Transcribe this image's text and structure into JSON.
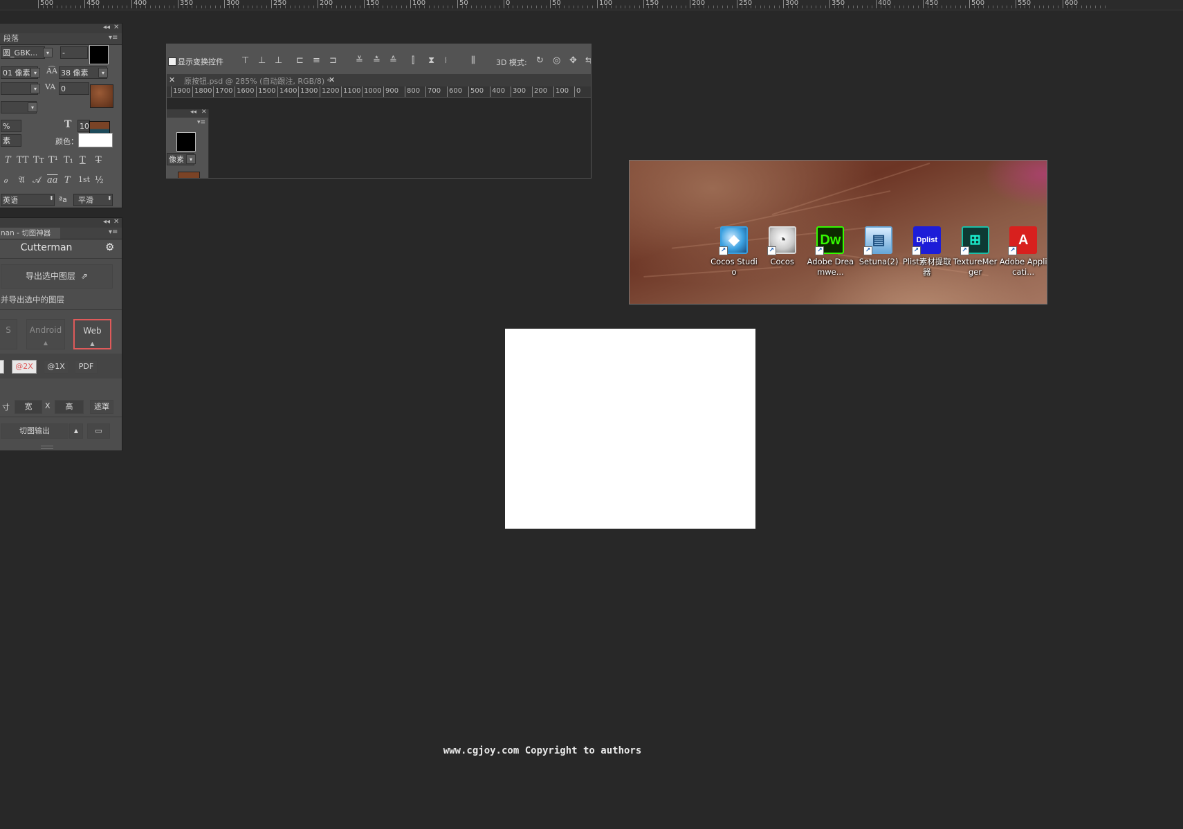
{
  "top_ruler": {
    "labels": [
      "500",
      "450",
      "400",
      "350",
      "300",
      "250",
      "200",
      "150",
      "100",
      "50",
      "0",
      "50",
      "100",
      "150",
      "200",
      "250",
      "300",
      "350",
      "400",
      "450",
      "500",
      "550",
      "600"
    ]
  },
  "char_panel": {
    "tabs": [
      "段落"
    ],
    "font_family": "圆_GBK...",
    "font_style": "-",
    "font_size": "01 像素",
    "leading": "38 像素",
    "kerning": "",
    "tracking": "0",
    "scale_field": "",
    "vertical_scale": "%",
    "horizontal_scale": "100",
    "baseline": "素",
    "color_label": "颜色：",
    "style_glyphs": [
      "T",
      "TT",
      "Tт",
      "T¹",
      "T₁",
      "T",
      "T"
    ],
    "opentype_glyphs": [
      "ℴ",
      "𝔄",
      "𝒜",
      "aa",
      "T",
      "1st",
      "½"
    ],
    "language": "英语",
    "aa_label": "ªa",
    "antialias": "平滑",
    "colors": {
      "text_color": "#000000",
      "swatch_brown": "#7a4326",
      "swatch_teal": "#1d4a5a"
    }
  },
  "cutterman": {
    "tab_title": "nan - 切图神器",
    "title": "Cutterman",
    "export_button": "导出选中图层",
    "hint": "并导出选中的图层",
    "platforms": [
      "S",
      "Android",
      "Web"
    ],
    "selected_platform": "Web",
    "scales": [
      "@2X",
      "@1X",
      "PDF"
    ],
    "size_label": "寸",
    "width_placeholder": "宽",
    "x_sep": "X",
    "height_placeholder": "高",
    "mask_button": "遮罩",
    "output_button": "切图输出",
    "colors": {
      "accent": "#e05a5a",
      "panel": "#535353"
    }
  },
  "doc_window": {
    "show_transform_label": "显示变换控件",
    "mode_3d_label": "3D 模式:",
    "tab_title": "原按钮.psd @ 285% (自动跟注, RGB/8) *",
    "ruler_labels": [
      "1900",
      "1800",
      "1700",
      "1600",
      "1500",
      "1400",
      "1300",
      "1200",
      "1100",
      "1000",
      "900",
      "800",
      "700",
      "600",
      "500",
      "400",
      "300",
      "200",
      "100",
      "0"
    ],
    "mini_panel_unit": "像素"
  },
  "desktop_icons": [
    {
      "label": "Cocos Studio",
      "icon": "cocos-studio-icon",
      "color": "#3aa0e0"
    },
    {
      "label": "Cocos",
      "icon": "cocos-icon",
      "color": "#d9d9d9"
    },
    {
      "label": "Adobe Dreamwe...",
      "icon": "dreamweaver-icon",
      "color": "#35fa00"
    },
    {
      "label": "Setuna(2)",
      "icon": "setuna-icon",
      "color": "#6aa8d8"
    },
    {
      "label": "Plist素材提取器",
      "icon": "plist-icon",
      "color": "#1d1dd8"
    },
    {
      "label": "TextureMerger",
      "icon": "texture-merger-icon",
      "color": "#1bbfa8"
    },
    {
      "label": "Adobe Applicati...",
      "icon": "adobe-icon",
      "color": "#d8201e"
    }
  ],
  "watermark": "www.cgjoy.com Copyright to authors"
}
